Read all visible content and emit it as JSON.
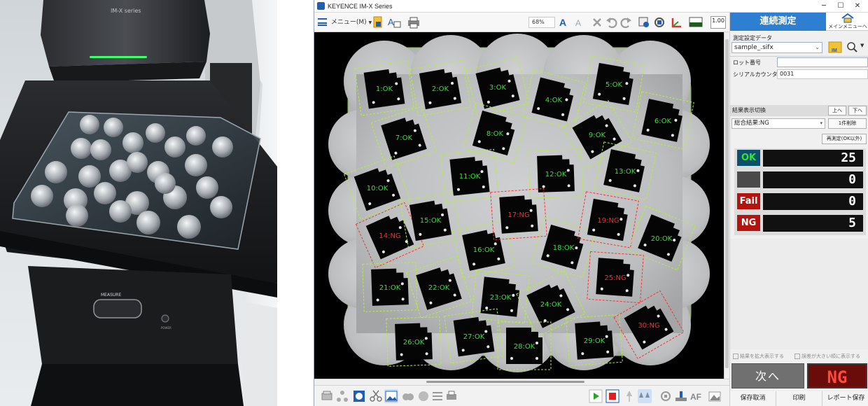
{
  "photo": {
    "device_model": "IM-X series",
    "measure_label": "MEASURE",
    "power_label": "POWER"
  },
  "window": {
    "title": "KEYENCE IM-X Series",
    "minimize": "─",
    "maximize": "☐",
    "close": "✕"
  },
  "toolbar": {
    "menu_label": "メニュー(M)",
    "zoom_value": "68%",
    "scale_value": "1.00"
  },
  "parts": [
    {
      "label": "1:OK",
      "status": "OK"
    },
    {
      "label": "2:OK",
      "status": "OK"
    },
    {
      "label": "3:OK",
      "status": "OK"
    },
    {
      "label": "4:OK",
      "status": "OK"
    },
    {
      "label": "5:OK",
      "status": "OK"
    },
    {
      "label": "6:OK",
      "status": "OK"
    },
    {
      "label": "7:OK",
      "status": "OK"
    },
    {
      "label": "8:OK",
      "status": "OK"
    },
    {
      "label": "9:OK",
      "status": "OK"
    },
    {
      "label": "10:OK",
      "status": "OK"
    },
    {
      "label": "11:OK",
      "status": "OK"
    },
    {
      "label": "12:OK",
      "status": "OK"
    },
    {
      "label": "13:OK",
      "status": "OK"
    },
    {
      "label": "14:NG",
      "status": "NG"
    },
    {
      "label": "15:OK",
      "status": "OK"
    },
    {
      "label": "16:OK",
      "status": "OK"
    },
    {
      "label": "17:NG",
      "status": "NG"
    },
    {
      "label": "18:OK",
      "status": "OK"
    },
    {
      "label": "19:NG",
      "status": "NG"
    },
    {
      "label": "20:OK",
      "status": "OK"
    },
    {
      "label": "21:OK",
      "status": "OK"
    },
    {
      "label": "22:OK",
      "status": "OK"
    },
    {
      "label": "23:OK",
      "status": "OK"
    },
    {
      "label": "24:OK",
      "status": "OK"
    },
    {
      "label": "25:NG",
      "status": "NG"
    },
    {
      "label": "26:OK",
      "status": "OK"
    },
    {
      "label": "27:OK",
      "status": "OK"
    },
    {
      "label": "28:OK",
      "status": "OK"
    },
    {
      "label": "29:OK",
      "status": "OK"
    },
    {
      "label": "30:NG",
      "status": "NG"
    }
  ],
  "side": {
    "tab_continuous": "連続測定",
    "tab_main_menu": "メインメニューへ",
    "settings_data_label": "測定設定データ",
    "settings_file": "sample_.sifx",
    "lot_number_label": "ロット番号",
    "lot_number_value": "",
    "serial_counter_label": "シリアルカウンタ",
    "serial_counter_value": "0031",
    "result_switch_label": "結果表示切換",
    "up_button": "上へ",
    "down_button": "下へ",
    "overall_result": "総合結果:NG",
    "delete_one_button": "1件削除",
    "remeasure_button": "再測定(OK以外)",
    "counters": [
      {
        "label": "OK",
        "value": "25"
      },
      {
        "label": "",
        "value": "0"
      },
      {
        "label": "Fail",
        "value": "0"
      },
      {
        "label": "NG",
        "value": "5"
      }
    ],
    "check_enlarge": "結果を拡大表示する",
    "check_deviation": "誤差が大きい順に表示する",
    "next_button": "次へ",
    "big_result": "NG",
    "save_cancel": "保存取消",
    "print": "印刷",
    "report_save": "レポート保存"
  },
  "colors": {
    "ok": "#2ee82e",
    "ng": "#ff2a2a",
    "accent": "#2e7fd1",
    "ok_box": "#b4ee3c",
    "ng_box": "#ff3030"
  }
}
